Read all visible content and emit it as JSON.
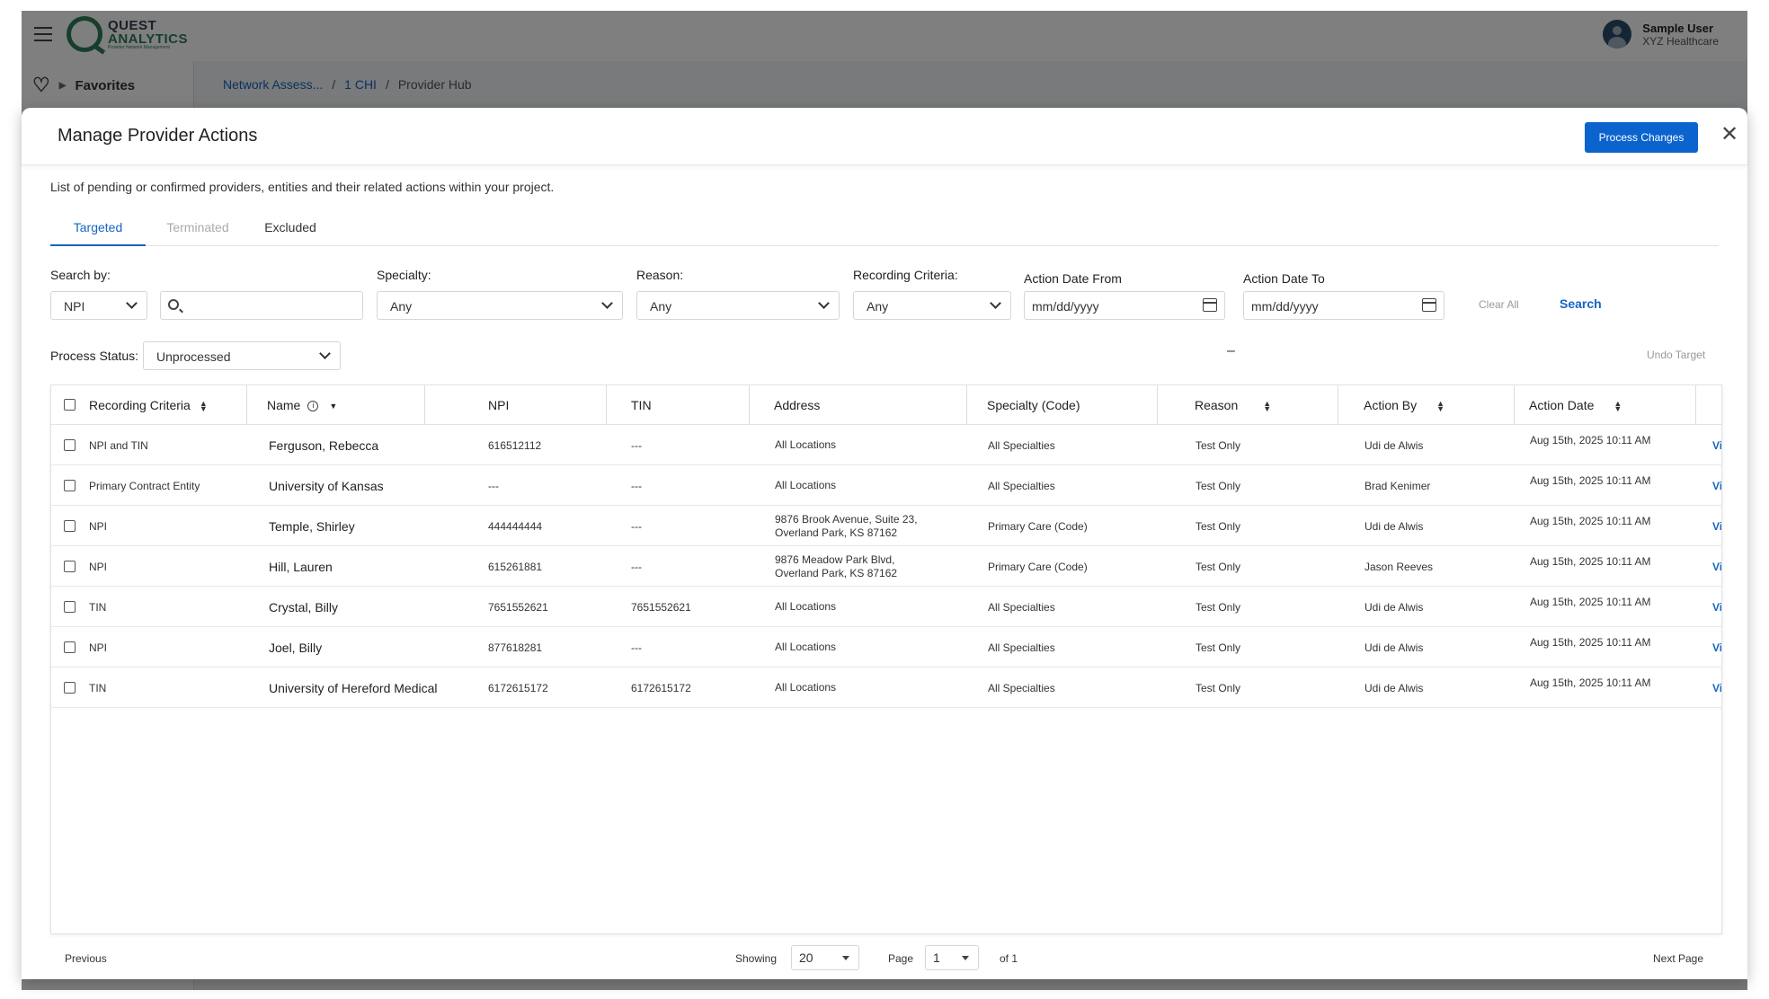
{
  "app": {
    "logo_line1": "QUEST",
    "logo_line2": "ANALYTICS",
    "logo_line3": "Provider Network Management",
    "user_name": "Sample User",
    "user_org": "XYZ Healthcare",
    "favorites_label": "Favorites",
    "breadcrumbs": [
      "Network Assess...",
      "1 CHI",
      "Provider Hub"
    ]
  },
  "modal": {
    "title": "Manage Provider Actions",
    "process_button": "Process Changes",
    "close_icon": "close-icon",
    "description": "List of pending or confirmed providers, entities and their related actions within your project.",
    "tabs": [
      {
        "label": "Targeted",
        "state": "active"
      },
      {
        "label": "Terminated",
        "state": "disabled"
      },
      {
        "label": "Excluded",
        "state": "normal"
      }
    ]
  },
  "filters": {
    "search_by_label": "Search by:",
    "search_by_value": "NPI",
    "search_text": "",
    "specialty_label": "Specialty:",
    "specialty_value": "Any",
    "reason_label": "Reason:",
    "reason_value": "Any",
    "criteria_label": "Recording Criteria:",
    "criteria_value": "Any",
    "date_from_label": "Action Date From",
    "date_from_placeholder": "mm/dd/yyyy",
    "date_to_label": "Action Date To",
    "date_to_placeholder": "mm/dd/yyyy",
    "dash": "–",
    "clear_all": "Clear All",
    "search": "Search",
    "process_status_label": "Process Status:",
    "process_status_value": "Unprocessed",
    "undo_target": "Undo Target"
  },
  "table": {
    "columns": [
      "Recording Criteria",
      "Name",
      "NPI",
      "TIN",
      "Address",
      "Specialty (Code)",
      "Reason",
      "Action By",
      "Action Date"
    ],
    "view_label": "Vie",
    "rows": [
      {
        "criteria": "NPI and TIN",
        "name": "Ferguson, Rebecca",
        "npi": "616512112",
        "tin": "---",
        "address": "All Locations",
        "specialty": "All Specialties",
        "reason": "Test Only",
        "action_by": "Udi de Alwis",
        "action_date": "Aug 15th, 2025 10:11 AM"
      },
      {
        "criteria": "Primary Contract Entity",
        "name": "University of Kansas",
        "npi": "---",
        "tin": "---",
        "address": "All Locations",
        "specialty": "All Specialties",
        "reason": "Test Only",
        "action_by": "Brad Kenimer",
        "action_date": "Aug 15th, 2025 10:11 AM"
      },
      {
        "criteria": "NPI",
        "name": "Temple, Shirley",
        "npi": "444444444",
        "tin": "---",
        "address": "9876 Brook Avenue, Suite 23,\nOverland Park, KS 87162",
        "specialty": "Primary Care (Code)",
        "reason": "Test Only",
        "action_by": "Udi de Alwis",
        "action_date": "Aug 15th, 2025 10:11 AM"
      },
      {
        "criteria": "NPI",
        "name": "Hill, Lauren",
        "npi": "615261881",
        "tin": "---",
        "address": "9876 Meadow Park Blvd,\nOverland Park, KS 87162",
        "specialty": "Primary Care (Code)",
        "reason": "Test Only",
        "action_by": "Jason Reeves",
        "action_date": "Aug 15th, 2025 10:11 AM"
      },
      {
        "criteria": "TIN",
        "name": "Crystal, Billy",
        "npi": "7651552621",
        "tin": "7651552621",
        "address": "All Locations",
        "specialty": "All Specialties",
        "reason": "Test Only",
        "action_by": "Udi de Alwis",
        "action_date": "Aug 15th, 2025 10:11 AM"
      },
      {
        "criteria": "NPI",
        "name": "Joel, Billy",
        "npi": "877618281",
        "tin": "---",
        "address": "All Locations",
        "specialty": "All Specialties",
        "reason": "Test Only",
        "action_by": "Udi de Alwis",
        "action_date": "Aug 15th, 2025 10:11 AM"
      },
      {
        "criteria": "TIN",
        "name": "University of Hereford Medical",
        "npi": "6172615172",
        "tin": "6172615172",
        "address": "All Locations",
        "specialty": "All Specialties",
        "reason": "Test Only",
        "action_by": "Udi de Alwis",
        "action_date": "Aug 15th, 2025 10:11 AM"
      }
    ]
  },
  "pagination": {
    "previous": "Previous",
    "showing_label": "Showing",
    "showing_value": "20",
    "page_label": "Page",
    "page_value": "1",
    "of_label": "of 1",
    "next": "Next Page"
  },
  "colors": {
    "primary": "#0b63ce",
    "link": "#1565c0",
    "brand_green": "#2e7d5b"
  }
}
